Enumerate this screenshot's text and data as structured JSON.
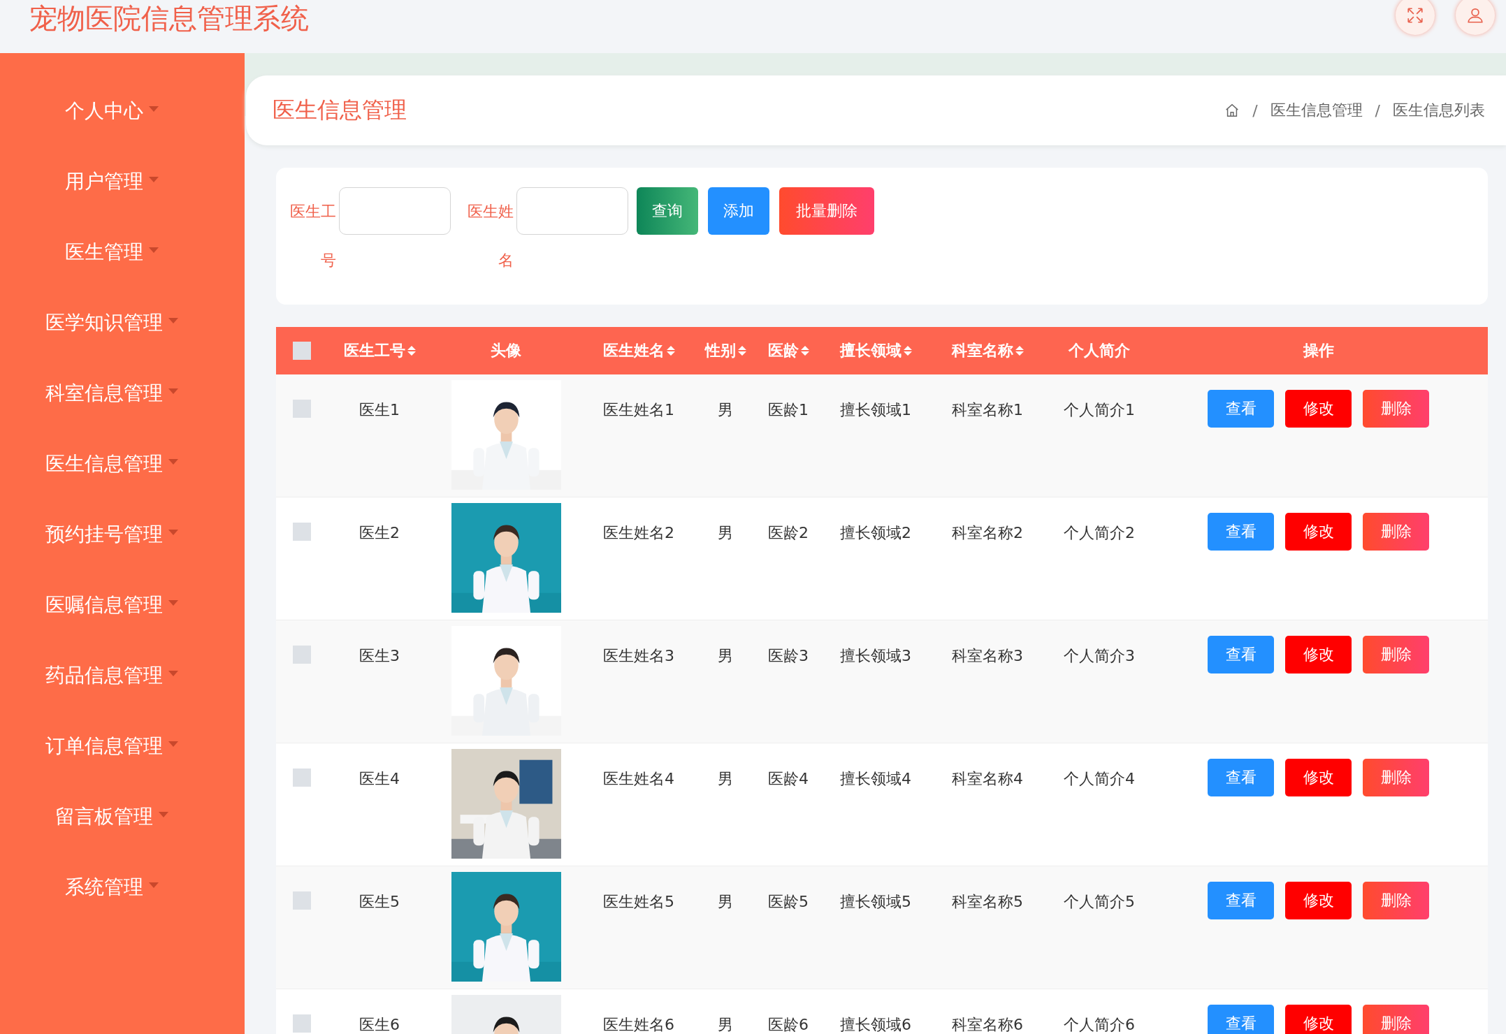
{
  "header": {
    "title": "宠物医院信息管理系统"
  },
  "sidebar": {
    "items": [
      {
        "label": "个人中心"
      },
      {
        "label": "用户管理"
      },
      {
        "label": "医生管理"
      },
      {
        "label": "医学知识管理"
      },
      {
        "label": "科室信息管理"
      },
      {
        "label": "医生信息管理"
      },
      {
        "label": "预约挂号管理"
      },
      {
        "label": "医嘱信息管理"
      },
      {
        "label": "药品信息管理"
      },
      {
        "label": "订单信息管理"
      },
      {
        "label": "留言板管理"
      },
      {
        "label": "系统管理"
      }
    ]
  },
  "page_header": {
    "title": "医生信息管理",
    "breadcrumb": [
      {
        "separator": "/",
        "label": "医生信息管理"
      },
      {
        "separator": "/",
        "label": "医生信息列表"
      }
    ]
  },
  "search": {
    "fields": [
      {
        "label": "医生工号"
      },
      {
        "label": "医生姓名"
      }
    ],
    "buttons": [
      {
        "label": "查询",
        "kind": "query"
      },
      {
        "label": "添加",
        "kind": "add"
      },
      {
        "label": "批量删除",
        "kind": "batch-delete"
      }
    ]
  },
  "table": {
    "select_all_checked": false,
    "columns": [
      {
        "label": "医生工号",
        "sortable": true
      },
      {
        "label": "头像",
        "sortable": false
      },
      {
        "label": "医生姓名",
        "sortable": true
      },
      {
        "label": "性别",
        "sortable": true
      },
      {
        "label": "医龄",
        "sortable": true
      },
      {
        "label": "擅长领域",
        "sortable": true
      },
      {
        "label": "科室名称",
        "sortable": true
      },
      {
        "label": "个人简介",
        "sortable": false
      },
      {
        "label": "操作",
        "sortable": false
      }
    ],
    "rows": [
      {
        "checked": false,
        "cells": [
          "医生1",
          {
            "kind": "picture"
          },
          "医生姓名1",
          "男",
          "医龄1",
          "擅长领域1",
          "科室名称1",
          "个人简介1",
          {
            "kind": "actions",
            "buttons": [
              {
                "label": "查看",
                "kind": "view"
              },
              {
                "label": "修改",
                "kind": "edit"
              },
              {
                "label": "删除",
                "kind": "delete"
              }
            ]
          }
        ]
      },
      {
        "checked": false,
        "cells": [
          "医生2",
          {
            "kind": "picture"
          },
          "医生姓名2",
          "男",
          "医龄2",
          "擅长领域2",
          "科室名称2",
          "个人简介2",
          {
            "kind": "actions",
            "buttons": [
              {
                "label": "查看",
                "kind": "view"
              },
              {
                "label": "修改",
                "kind": "edit"
              },
              {
                "label": "删除",
                "kind": "delete"
              }
            ]
          }
        ]
      },
      {
        "checked": false,
        "cells": [
          "医生3",
          {
            "kind": "picture"
          },
          "医生姓名3",
          "男",
          "医龄3",
          "擅长领域3",
          "科室名称3",
          "个人简介3",
          {
            "kind": "actions",
            "buttons": [
              {
                "label": "查看",
                "kind": "view"
              },
              {
                "label": "修改",
                "kind": "edit"
              },
              {
                "label": "删除",
                "kind": "delete"
              }
            ]
          }
        ]
      },
      {
        "checked": false,
        "cells": [
          "医生4",
          {
            "kind": "picture"
          },
          "医生姓名4",
          "男",
          "医龄4",
          "擅长领域4",
          "科室名称4",
          "个人简介4",
          {
            "kind": "actions",
            "buttons": [
              {
                "label": "查看",
                "kind": "view"
              },
              {
                "label": "修改",
                "kind": "edit"
              },
              {
                "label": "删除",
                "kind": "delete"
              }
            ]
          }
        ]
      },
      {
        "checked": false,
        "cells": [
          "医生5",
          {
            "kind": "picture"
          },
          "医生姓名5",
          "男",
          "医龄5",
          "擅长领域5",
          "科室名称5",
          "个人简介5",
          {
            "kind": "actions",
            "buttons": [
              {
                "label": "查看",
                "kind": "view"
              },
              {
                "label": "修改",
                "kind": "edit"
              },
              {
                "label": "删除",
                "kind": "delete"
              }
            ]
          }
        ]
      },
      {
        "checked": false,
        "cells": [
          "医生6",
          {
            "kind": "picture"
          },
          "医生姓名6",
          "男",
          "医龄6",
          "擅长领域6",
          "科室名称6",
          "个人简介6",
          {
            "kind": "actions",
            "buttons": [
              {
                "label": "查看",
                "kind": "view"
              },
              {
                "label": "修改",
                "kind": "edit"
              },
              {
                "label": "删除",
                "kind": "delete"
              }
            ]
          }
        ]
      }
    ]
  }
}
